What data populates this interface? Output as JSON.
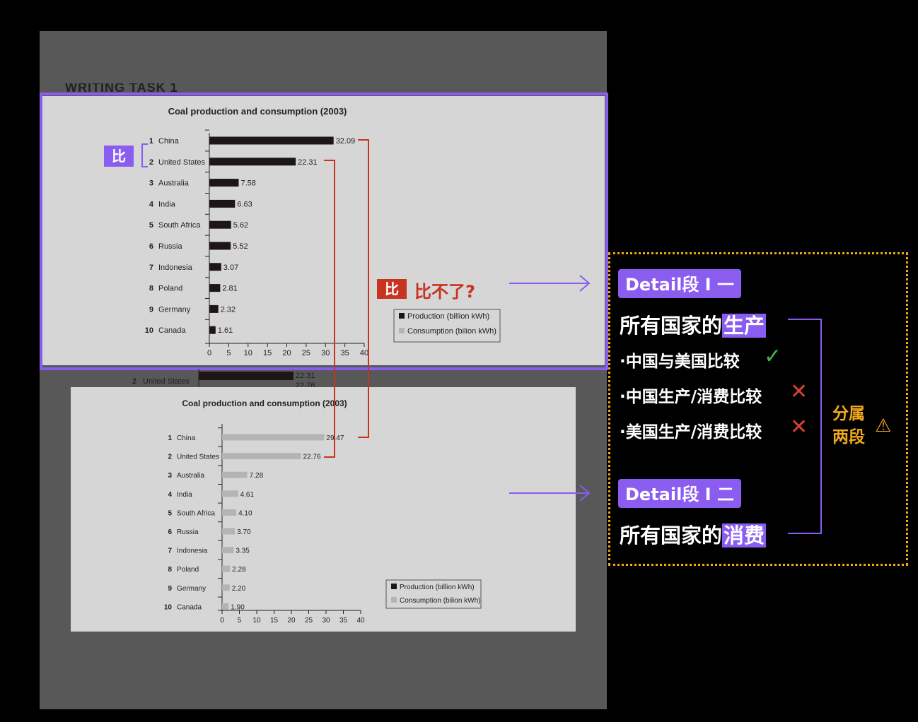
{
  "strip_text": "WRITING TASK 1",
  "colors": {
    "accent_purple": "#8a5cf0",
    "accent_red": "#c7341f",
    "accent_orange": "#f0a81c",
    "production_bar": "#1e1616",
    "consumption_bar": "#b4b4b4",
    "chart_bg": "#d6d6d6"
  },
  "chart_data": [
    {
      "type": "bar",
      "orientation": "horizontal",
      "title": "Coal production and consumption (2003)",
      "ranks": [
        "1",
        "2",
        "3",
        "4",
        "5",
        "6",
        "7",
        "8",
        "9",
        "10"
      ],
      "categories": [
        "China",
        "United States",
        "Australia",
        "India",
        "South Africa",
        "Russia",
        "Indonesia",
        "Poland",
        "Germany",
        "Canada"
      ],
      "series": [
        {
          "name": "Production (billion kWh)",
          "values": [
            32.09,
            22.31,
            7.58,
            6.63,
            5.62,
            5.52,
            3.07,
            2.81,
            2.32,
            1.61
          ],
          "labels": [
            "32.09",
            "22.31",
            "7.58",
            "6.63",
            "5.62",
            "5.52",
            "3.07",
            "2.81",
            "2.32",
            "1.61"
          ],
          "color": "#1e1616"
        }
      ],
      "legend": [
        "Production (billion kWh)",
        "Consumption (bilion kWh)"
      ],
      "legend_position": "bottom-right",
      "xlim": [
        0,
        40
      ],
      "xticks": [
        "0",
        "5",
        "10",
        "15",
        "20",
        "25",
        "30",
        "35",
        "40"
      ],
      "grid": false
    },
    {
      "type": "bar",
      "orientation": "horizontal",
      "title": "Coal production and consumption (2003)",
      "ranks": [
        "1",
        "2",
        "3",
        "4",
        "5",
        "6",
        "7",
        "8",
        "9",
        "10"
      ],
      "categories": [
        "China",
        "United States",
        "Australia",
        "India",
        "South Africa",
        "Russia",
        "Indonesia",
        "Poland",
        "Germany",
        "Canada"
      ],
      "series": [
        {
          "name": "Consumption (bilion kWh)",
          "values": [
            29.47,
            22.76,
            7.28,
            4.61,
            4.1,
            3.7,
            3.35,
            2.28,
            2.2,
            1.9
          ],
          "labels": [
            "29.47",
            "22.76",
            "7.28",
            "4.61",
            "4.10",
            "3.70",
            "3.35",
            "2.28",
            "2.20",
            "1.90"
          ],
          "color": "#b4b4b4"
        }
      ],
      "legend": [
        "Production (billion kWh)",
        "Consumption (bilion kWh)"
      ],
      "legend_position": "bottom-right",
      "xlim": [
        0,
        40
      ],
      "xticks": [
        "0",
        "5",
        "10",
        "15",
        "20",
        "25",
        "30",
        "35",
        "40"
      ],
      "grid": false
    }
  ],
  "peek": {
    "rank": "2",
    "country": "United States",
    "value1": "22.31",
    "value2": "22.76"
  },
  "annotations": {
    "compare_tag": "比",
    "compare_red_tag": "比",
    "cannot_compare": "比不了?",
    "detail1_tag": "Detail段 I 一",
    "detail1_heading_prefix": "所有国家的",
    "detail1_heading_highlight": "生产",
    "bullets": [
      {
        "text": "·中国与美国比较",
        "status": "check"
      },
      {
        "text": "·中国生产/消费比较",
        "status": "cross"
      },
      {
        "text": "·美国生产/消费比较",
        "status": "cross"
      }
    ],
    "check_mark": "✓",
    "cross_mark": "✕",
    "separate_line1": "分属",
    "separate_line2": "两段",
    "warning_icon": "⚠",
    "detail2_tag": "Detail段 I 二",
    "detail2_heading_prefix": "所有国家的",
    "detail2_heading_highlight": "消费"
  }
}
